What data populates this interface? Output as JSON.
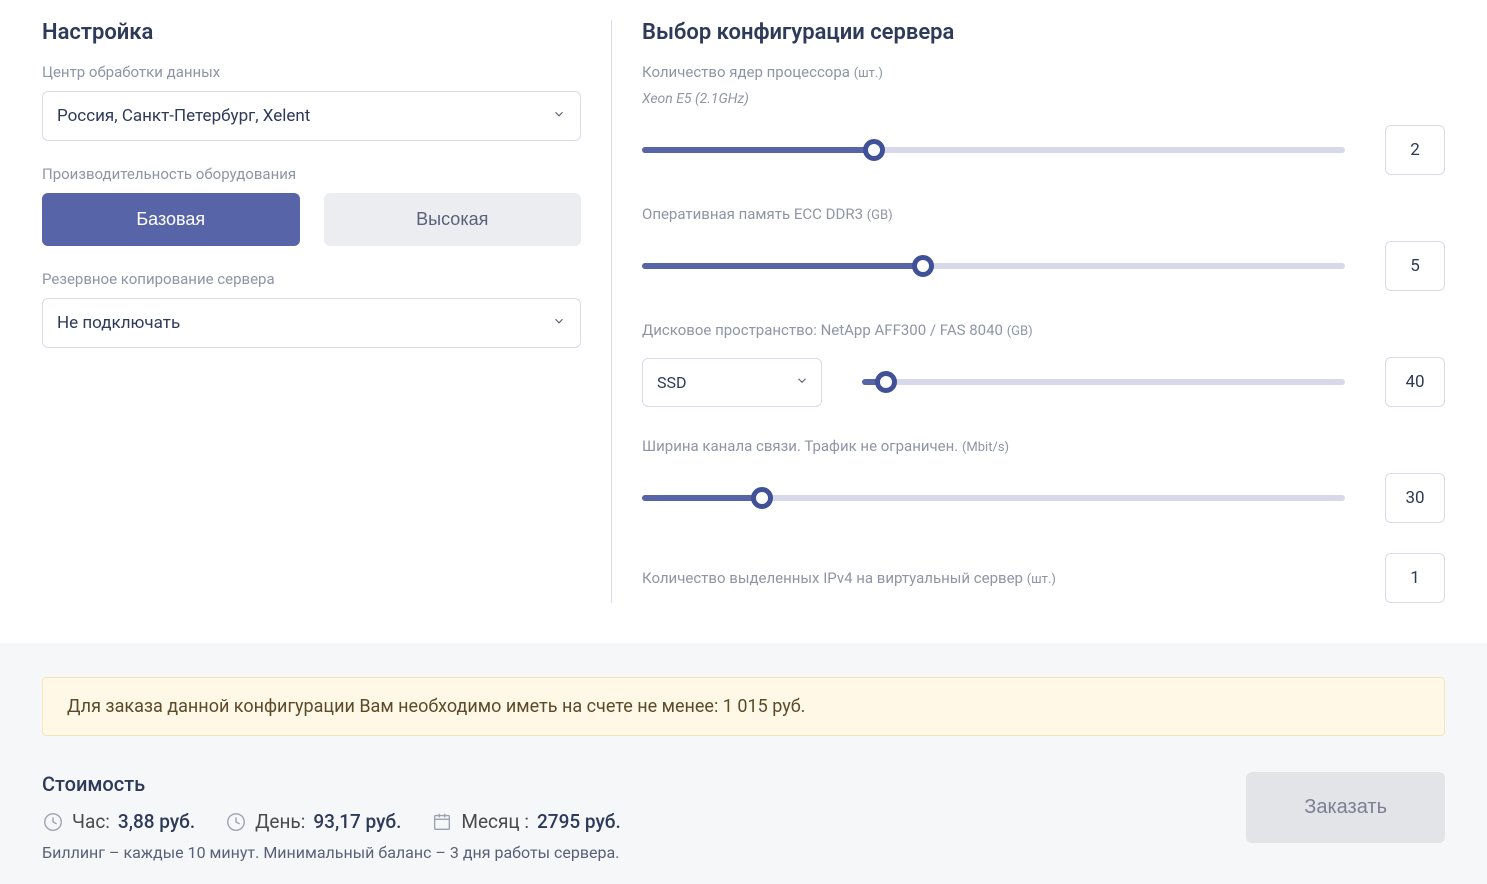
{
  "left": {
    "title": "Настройка",
    "datacenter_label": "Центр обработки данных",
    "datacenter_value": "Россия, Санкт-Петербург, Xelent",
    "perf_label": "Производительность оборудования",
    "perf_basic": "Базовая",
    "perf_high": "Высокая",
    "backup_label": "Резервное копирование сервера",
    "backup_value": "Не подключать"
  },
  "right": {
    "title": "Выбор конфигурации сервера",
    "cpu_label": "Количество ядер процессора",
    "cpu_unit": "(шт.)",
    "cpu_sub": "Xeon E5 (2.1GHz)",
    "cpu_value": "2",
    "cpu_fill": "33",
    "ram_label": "Оперативная память ECC DDR3",
    "ram_unit": "(GB)",
    "ram_value": "5",
    "ram_fill": "40",
    "disk_label": "Дисковое пространство: NetApp AFF300 / FAS 8040",
    "disk_unit": "(GB)",
    "disk_type": "SSD",
    "disk_value": "40",
    "disk_fill": "5",
    "bw_label": "Ширина канала связи. Трафик не ограничен.",
    "bw_unit": "(Mbit/s)",
    "bw_value": "30",
    "bw_fill": "17",
    "ip_label": "Количество выделенных IPv4 на виртуальный сервер",
    "ip_unit": "(шт.)",
    "ip_value": "1"
  },
  "bottom": {
    "alert": "Для заказа данной конфигурации Вам необходимо иметь на счете не менее: 1 015 руб.",
    "cost_title": "Стоимость",
    "hour_label": "Час:",
    "hour_value": "3,88 руб.",
    "day_label": "День:",
    "day_value": "93,17 руб.",
    "month_label": "Месяц :",
    "month_value": "2795 руб.",
    "billing_note": "Биллинг – каждые 10 минут. Минимальный баланс – 3 дня работы сервера.",
    "order_label": "Заказать"
  }
}
